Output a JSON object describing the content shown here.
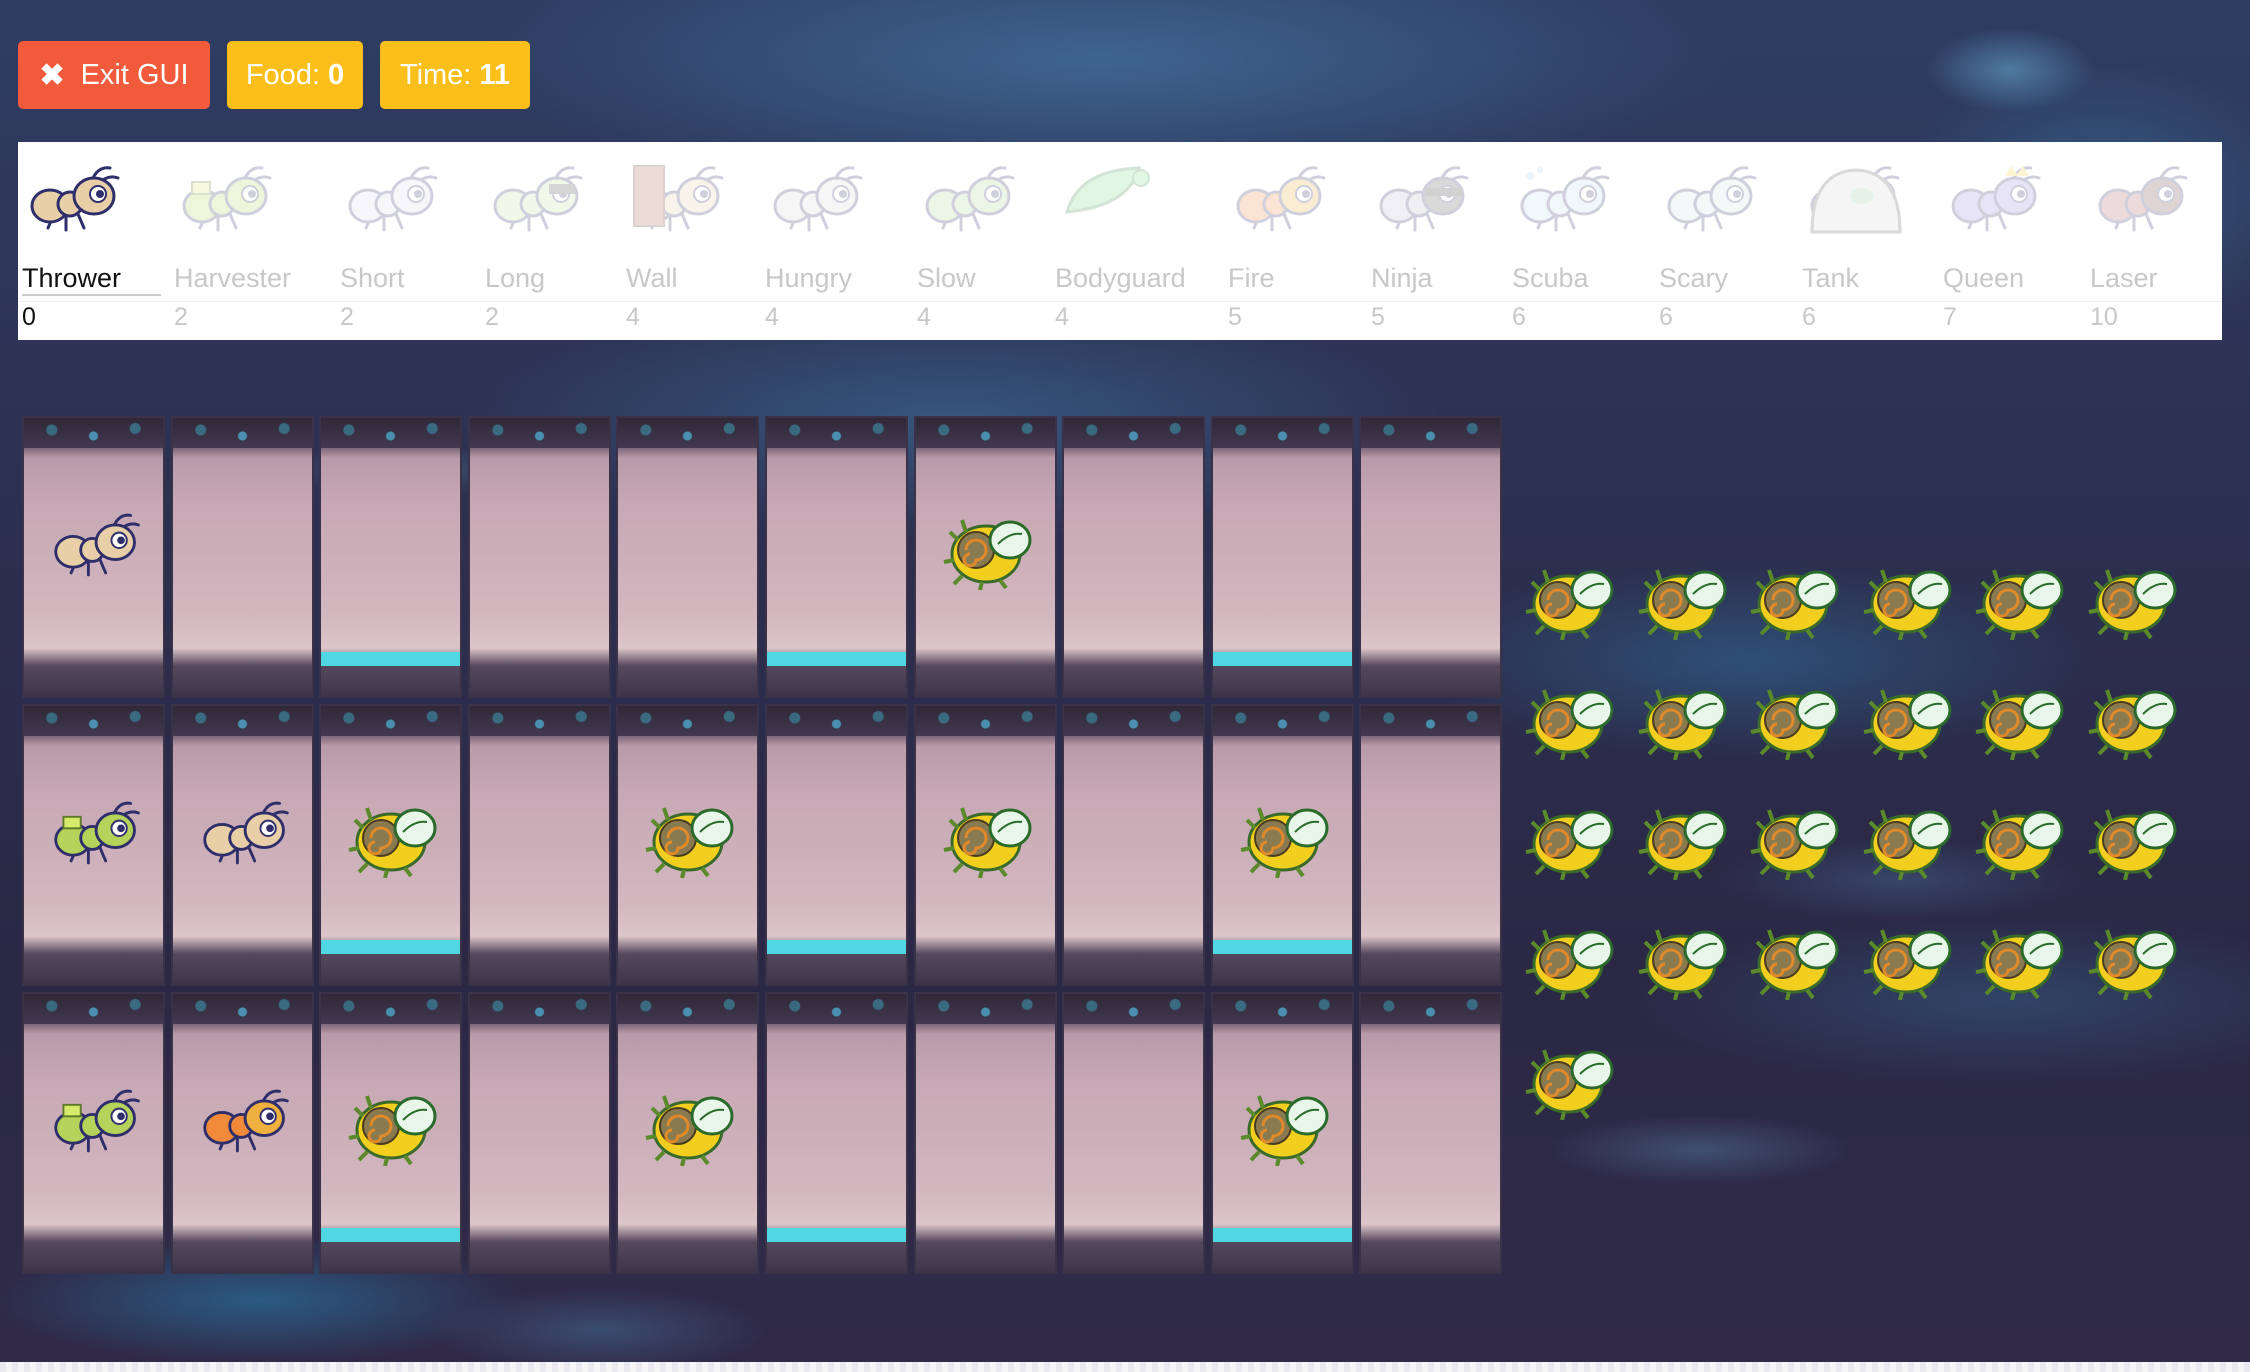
{
  "controls": {
    "exit_label": "Exit GUI",
    "food_label": "Food:",
    "food_value": "0",
    "time_label": "Time:",
    "time_value": "11"
  },
  "colors": {
    "exit": "#f15a3a",
    "badge": "#fbbf1b",
    "water": "#4fd7e4"
  },
  "ant_types": [
    {
      "name": "Thrower",
      "cost": "0",
      "icon": "thrower-ant-icon",
      "selected": true
    },
    {
      "name": "Harvester",
      "cost": "2",
      "icon": "harvester-ant-icon"
    },
    {
      "name": "Short",
      "cost": "2",
      "icon": "short-thrower-ant-icon"
    },
    {
      "name": "Long",
      "cost": "2",
      "icon": "long-thrower-ant-icon"
    },
    {
      "name": "Wall",
      "cost": "4",
      "icon": "wall-ant-icon"
    },
    {
      "name": "Hungry",
      "cost": "4",
      "icon": "hungry-ant-icon"
    },
    {
      "name": "Slow",
      "cost": "4",
      "icon": "slow-thrower-ant-icon"
    },
    {
      "name": "Bodyguard",
      "cost": "4",
      "icon": "bodyguard-ant-icon"
    },
    {
      "name": "Fire",
      "cost": "5",
      "icon": "fire-ant-icon"
    },
    {
      "name": "Ninja",
      "cost": "5",
      "icon": "ninja-ant-icon"
    },
    {
      "name": "Scuba",
      "cost": "6",
      "icon": "scuba-thrower-ant-icon"
    },
    {
      "name": "Scary",
      "cost": "6",
      "icon": "scary-thrower-ant-icon"
    },
    {
      "name": "Tank",
      "cost": "6",
      "icon": "tank-ant-icon"
    },
    {
      "name": "Queen",
      "cost": "7",
      "icon": "queen-ant-icon"
    },
    {
      "name": "Laser",
      "cost": "10",
      "icon": "laser-ant-icon"
    }
  ],
  "board": {
    "water_columns": [
      2,
      5,
      8
    ],
    "rows": [
      [
        {
          "ant": "thrower"
        },
        {},
        {},
        {},
        {},
        {},
        {
          "bees": 1
        },
        {},
        {},
        {}
      ],
      [
        {
          "ant": "harvester"
        },
        {
          "ant": "thrower"
        },
        {
          "bees": 1
        },
        {},
        {
          "bees": 1
        },
        {},
        {
          "bees": 1
        },
        {},
        {
          "bees": 1
        },
        {}
      ],
      [
        {
          "ant": "harvester"
        },
        {
          "ant": "fire"
        },
        {
          "bees": 1
        },
        {},
        {
          "bees": 1
        },
        {},
        {},
        {},
        {
          "bees": 1
        },
        {}
      ]
    ]
  },
  "hive": {
    "bee_count": 25,
    "bees_per_row": 6
  }
}
